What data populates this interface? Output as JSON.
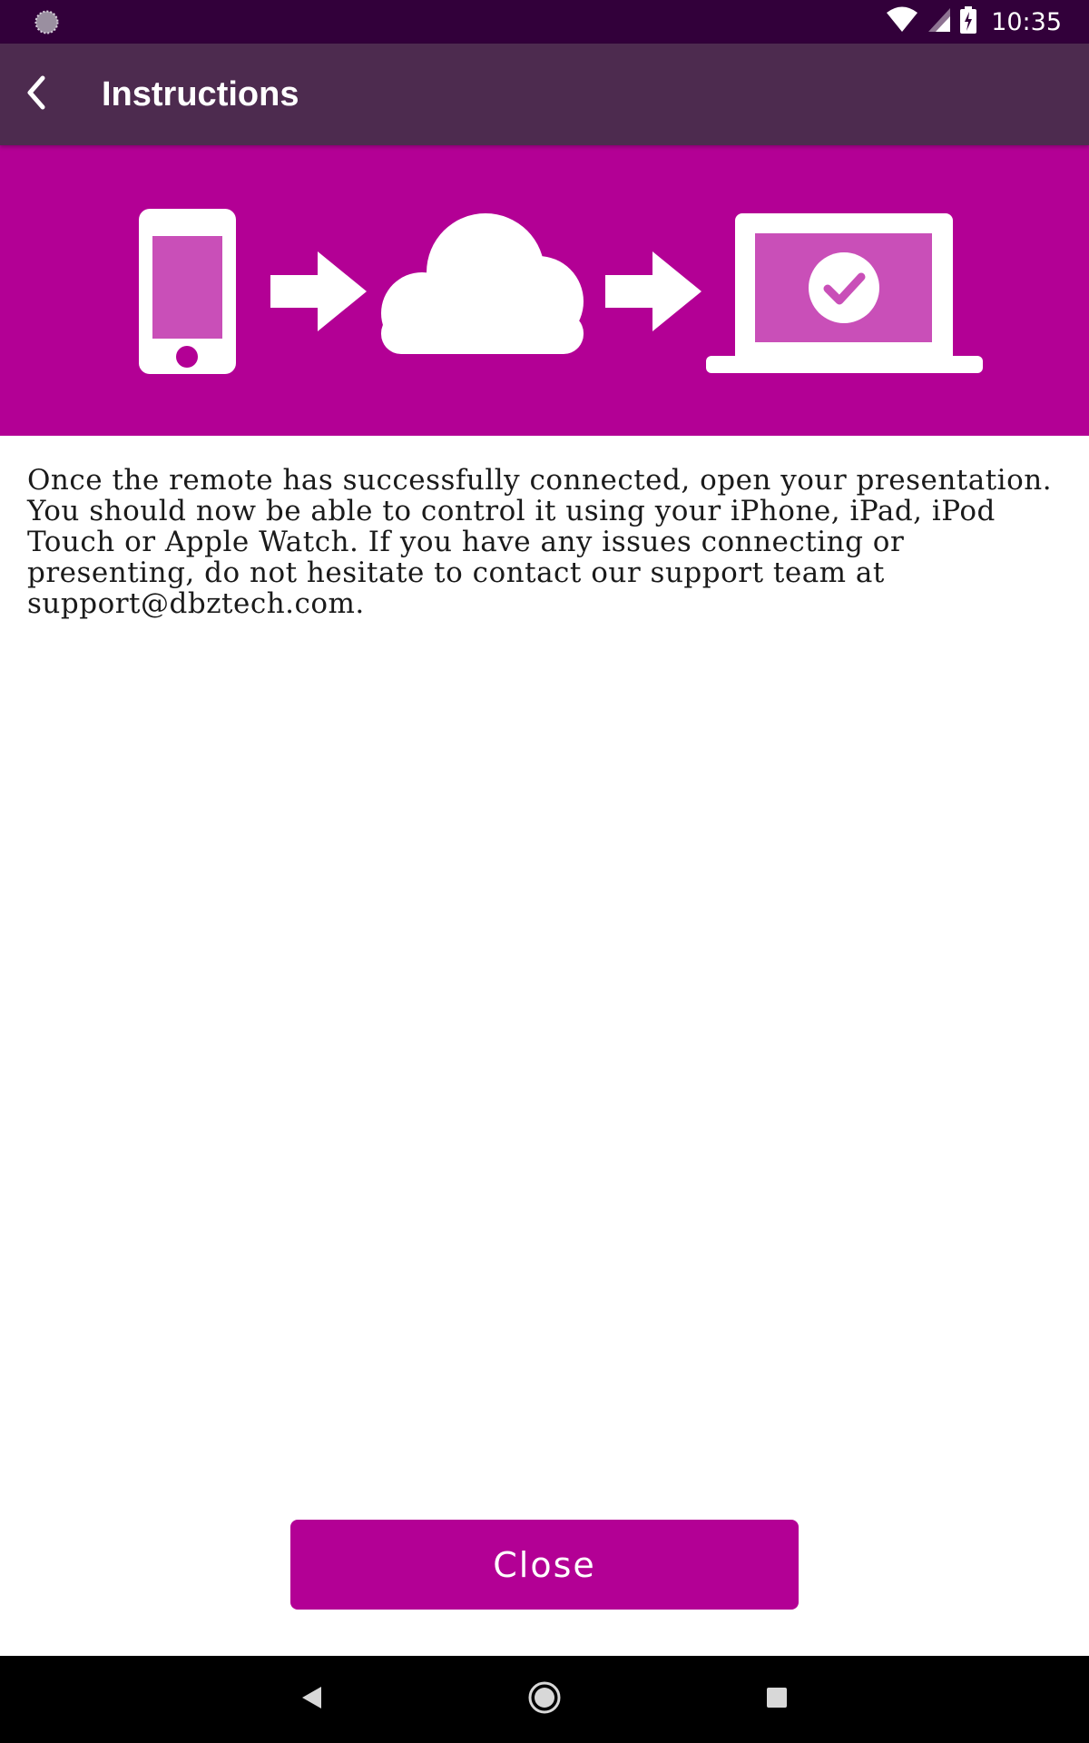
{
  "status_bar": {
    "time": "10:35",
    "left_icon": "loading-spinner-icon",
    "icons": [
      "wifi-icon",
      "signal-icon",
      "battery-charging-icon"
    ]
  },
  "app_bar": {
    "title": "Instructions",
    "back_icon": "back-arrow-icon"
  },
  "banner": {
    "background_color": "#b30095",
    "icons": [
      "phone-icon",
      "arrow-right-icon",
      "cloud-icon",
      "arrow-right-icon",
      "laptop-check-icon"
    ]
  },
  "content": {
    "instructions": "Once the remote has successfully connected, open your presentation. You should now be able to control it using your iPhone, iPad, iPod Touch or Apple Watch. If you have any issues connecting or presenting, do not hesitate to contact our support team at support@dbztech.com."
  },
  "actions": {
    "close_label": "Close"
  },
  "nav_bar": {
    "buttons": [
      "nav-back-icon",
      "nav-home-icon",
      "nav-recents-icon"
    ]
  },
  "colors": {
    "status_bar": "#32003a",
    "app_bar": "#4d2b4f",
    "accent": "#b30095",
    "accent_light": "#c94fb8"
  }
}
